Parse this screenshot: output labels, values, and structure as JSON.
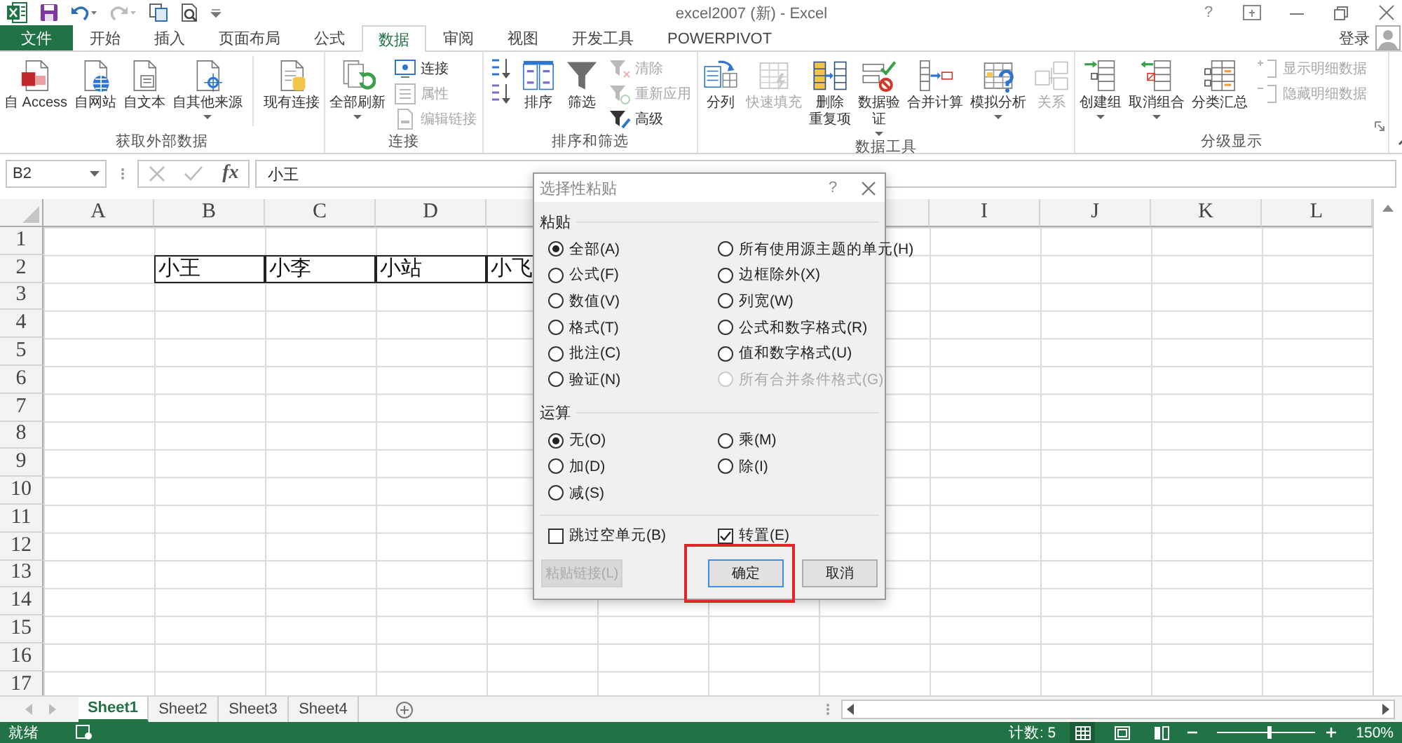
{
  "window": {
    "title": "excel2007 (新) - Excel",
    "help": "?"
  },
  "tabs": [
    {
      "label": "文件",
      "kind": "file",
      "selected": false
    },
    {
      "label": "开始",
      "kind": "tab",
      "selected": false
    },
    {
      "label": "插入",
      "kind": "tab",
      "selected": false
    },
    {
      "label": "页面布局",
      "kind": "tab",
      "selected": false
    },
    {
      "label": "公式",
      "kind": "tab",
      "selected": false
    },
    {
      "label": "数据",
      "kind": "tab",
      "selected": true
    },
    {
      "label": "审阅",
      "kind": "tab",
      "selected": false
    },
    {
      "label": "视图",
      "kind": "tab",
      "selected": false
    },
    {
      "label": "开发工具",
      "kind": "tab",
      "selected": false
    },
    {
      "label": "POWERPIVOT",
      "kind": "tab",
      "selected": false
    }
  ],
  "account": {
    "sign_in": "登录"
  },
  "ribbon": {
    "groups": [
      {
        "label": "获取外部数据",
        "items": [
          {
            "kind": "large",
            "label": "自 Access",
            "disabled": false
          },
          {
            "kind": "large",
            "label": "自网站",
            "disabled": false
          },
          {
            "kind": "large",
            "label": "自文本",
            "disabled": false
          },
          {
            "kind": "large",
            "label": "自其他来源",
            "dropdown": true,
            "disabled": false
          },
          {
            "kind": "large",
            "label": "现有连接",
            "disabled": false
          }
        ]
      },
      {
        "label": "连接",
        "items": [
          {
            "kind": "large",
            "label": "全部刷新",
            "dropdown": true,
            "disabled": false
          },
          {
            "kind": "small",
            "label": "连接",
            "disabled": false
          },
          {
            "kind": "small",
            "label": "属性",
            "disabled": true
          },
          {
            "kind": "small",
            "label": "编辑链接",
            "disabled": true
          }
        ]
      },
      {
        "label": "排序和筛选",
        "items": [
          {
            "kind": "icon",
            "disabled": false
          },
          {
            "kind": "icon",
            "disabled": false
          },
          {
            "kind": "large",
            "label": "排序",
            "disabled": false
          },
          {
            "kind": "large",
            "label": "筛选",
            "disabled": false
          },
          {
            "kind": "small",
            "label": "清除",
            "disabled": true
          },
          {
            "kind": "small",
            "label": "重新应用",
            "disabled": true
          },
          {
            "kind": "small",
            "label": "高级",
            "disabled": false
          }
        ]
      },
      {
        "label": "数据工具",
        "items": [
          {
            "kind": "large",
            "label": "分列",
            "disabled": false
          },
          {
            "kind": "large",
            "label": "快速填充",
            "disabled": true
          },
          {
            "kind": "large",
            "lines": [
              "删除",
              "重复项"
            ],
            "disabled": false
          },
          {
            "kind": "large",
            "lines": [
              "数据验",
              "证"
            ],
            "dropdown": true,
            "disabled": false
          },
          {
            "kind": "large",
            "label": "合并计算",
            "disabled": false
          },
          {
            "kind": "large",
            "label": "模拟分析",
            "dropdown": true,
            "disabled": false
          },
          {
            "kind": "large",
            "label": "关系",
            "disabled": true
          }
        ]
      },
      {
        "label": "分级显示",
        "items": [
          {
            "kind": "large",
            "label": "创建组",
            "dropdown": true,
            "disabled": false
          },
          {
            "kind": "large",
            "label": "取消组合",
            "dropdown": true,
            "disabled": false
          },
          {
            "kind": "large",
            "label": "分类汇总",
            "disabled": false
          },
          {
            "kind": "small",
            "label": "显示明细数据",
            "disabled": true
          },
          {
            "kind": "small",
            "label": "隐藏明细数据",
            "disabled": true
          }
        ]
      }
    ]
  },
  "formula_bar": {
    "name_box": "B2",
    "function_label": "fx",
    "value": "小王"
  },
  "sheet": {
    "columns": [
      "A",
      "B",
      "C",
      "D",
      null,
      null,
      null,
      null,
      "I",
      "J",
      "K",
      "L"
    ],
    "rows": [
      {
        "number": "1",
        "cells": []
      },
      {
        "number": "2",
        "cells": [
          null,
          "小王",
          "小李",
          "小站",
          "小飞"
        ]
      },
      {
        "number": "3",
        "cells": []
      },
      {
        "number": "4",
        "cells": []
      },
      {
        "number": "5",
        "cells": []
      },
      {
        "number": "6",
        "cells": []
      },
      {
        "number": "7",
        "cells": []
      },
      {
        "number": "8",
        "cells": []
      },
      {
        "number": "9",
        "cells": []
      },
      {
        "number": "10",
        "cells": []
      },
      {
        "number": "11",
        "cells": []
      },
      {
        "number": "12",
        "cells": []
      },
      {
        "number": "13",
        "cells": []
      },
      {
        "number": "14",
        "cells": []
      },
      {
        "number": "15",
        "cells": []
      },
      {
        "number": "16",
        "cells": []
      },
      {
        "number": "17",
        "cells": []
      }
    ]
  },
  "dialog": {
    "title": "选择性粘贴",
    "help": "?",
    "paste_label": "粘贴",
    "paste_options": [
      {
        "label": "全部(A)",
        "selected": true,
        "disabled": false
      },
      {
        "label": "所有使用源主题的单元(H)",
        "selected": false,
        "disabled": false
      },
      {
        "label": "公式(F)",
        "selected": false,
        "disabled": false
      },
      {
        "label": "边框除外(X)",
        "selected": false,
        "disabled": false
      },
      {
        "label": "数值(V)",
        "selected": false,
        "disabled": false
      },
      {
        "label": "列宽(W)",
        "selected": false,
        "disabled": false
      },
      {
        "label": "格式(T)",
        "selected": false,
        "disabled": false
      },
      {
        "label": "公式和数字格式(R)",
        "selected": false,
        "disabled": false
      },
      {
        "label": "批注(C)",
        "selected": false,
        "disabled": false
      },
      {
        "label": "值和数字格式(U)",
        "selected": false,
        "disabled": false
      },
      {
        "label": "验证(N)",
        "selected": false,
        "disabled": false
      },
      {
        "label": "所有合并条件格式(G)",
        "selected": false,
        "disabled": true
      }
    ],
    "operation_label": "运算",
    "operation_options": [
      {
        "label": "无(O)",
        "selected": true,
        "disabled": false
      },
      {
        "label": "乘(M)",
        "selected": false,
        "disabled": false
      },
      {
        "label": "加(D)",
        "selected": false,
        "disabled": false
      },
      {
        "label": "除(I)",
        "selected": false,
        "disabled": false
      },
      {
        "label": "减(S)",
        "selected": false,
        "disabled": false
      }
    ],
    "checkboxes": [
      {
        "label": "跳过空单元(B)",
        "checked": false
      },
      {
        "label": "转置(E)",
        "checked": true
      }
    ],
    "buttons": [
      {
        "label": "粘贴链接(L)",
        "disabled": true,
        "highlighted": false
      },
      {
        "label": "确定",
        "disabled": false,
        "highlighted": true
      },
      {
        "label": "取消",
        "disabled": false,
        "highlighted": false
      }
    ]
  },
  "sheet_tabs": [
    {
      "label": "Sheet1",
      "selected": true
    },
    {
      "label": "Sheet2",
      "selected": false
    },
    {
      "label": "Sheet3",
      "selected": false
    },
    {
      "label": "Sheet4",
      "selected": false
    }
  ],
  "status_bar": {
    "status": "就绪",
    "count": "计数: 5",
    "zoom": {
      "level": 0.53,
      "reading": "150%"
    }
  }
}
